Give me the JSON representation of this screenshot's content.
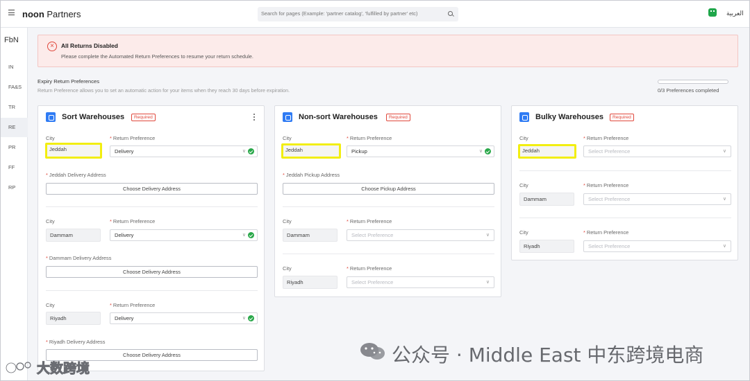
{
  "header": {
    "brand_bold": "noon",
    "brand_rest": " Partners",
    "search_placeholder": "Search for pages (Example: 'partner catalog', 'fulfilled by partner' etc)",
    "language": "العربية"
  },
  "sidebar": {
    "logo": "FbN",
    "items": [
      {
        "label": "IN"
      },
      {
        "label": "FA&S"
      },
      {
        "label": "TR"
      },
      {
        "label": "RE"
      },
      {
        "label": "PR"
      },
      {
        "label": "FF"
      },
      {
        "label": "RP"
      }
    ]
  },
  "alert": {
    "title": "All Returns Disabled",
    "message": "Please complete the Automated Return Preferences to resume your return schedule."
  },
  "section": {
    "title": "Expiry Return Preferences",
    "subtitle": "Return Preference allows you to set an automatic action for your items when they reach 30 days before expiration.",
    "progress_value": 0,
    "progress_text": "0/3 Preferences completed"
  },
  "labels": {
    "city": "City",
    "return_pref": "Return Preference",
    "required": "Required"
  },
  "cards": [
    {
      "title": "Sort Warehouses",
      "rows": [
        {
          "city": "Jeddah",
          "pref": "Delivery",
          "addr_label": "Jeddah Delivery Address",
          "addr_btn": "Choose Delivery Address"
        },
        {
          "city": "Dammam",
          "pref": "Delivery",
          "addr_label": "Dammam Delivery Address",
          "addr_btn": "Choose Delivery Address"
        },
        {
          "city": "Riyadh",
          "pref": "Delivery",
          "addr_label": "Riyadh Delivery Address",
          "addr_btn": "Choose Delivery Address"
        }
      ]
    },
    {
      "title": "Non-sort Warehouses",
      "rows": [
        {
          "city": "Jeddah",
          "pref": "Pickup",
          "addr_label": "Jeddah Pickup Address",
          "addr_btn": "Choose Pickup Address"
        },
        {
          "city": "Dammam",
          "pref": "Select Preference"
        },
        {
          "city": "Riyadh",
          "pref": "Select Preference"
        }
      ]
    },
    {
      "title": "Bulky Warehouses",
      "rows": [
        {
          "city": "Jeddah",
          "pref": "Select Preference"
        },
        {
          "city": "Dammam",
          "pref": "Select Preference"
        },
        {
          "city": "Riyadh",
          "pref": "Select Preference"
        }
      ]
    }
  ],
  "watermarks": {
    "right": "公众号 · Middle East 中东跨境电商",
    "left": "大数跨境"
  },
  "colors": {
    "accent": "#2f7bf4",
    "error": "#e0473b",
    "success": "#2aa84a",
    "highlight": "#f2ee10"
  }
}
